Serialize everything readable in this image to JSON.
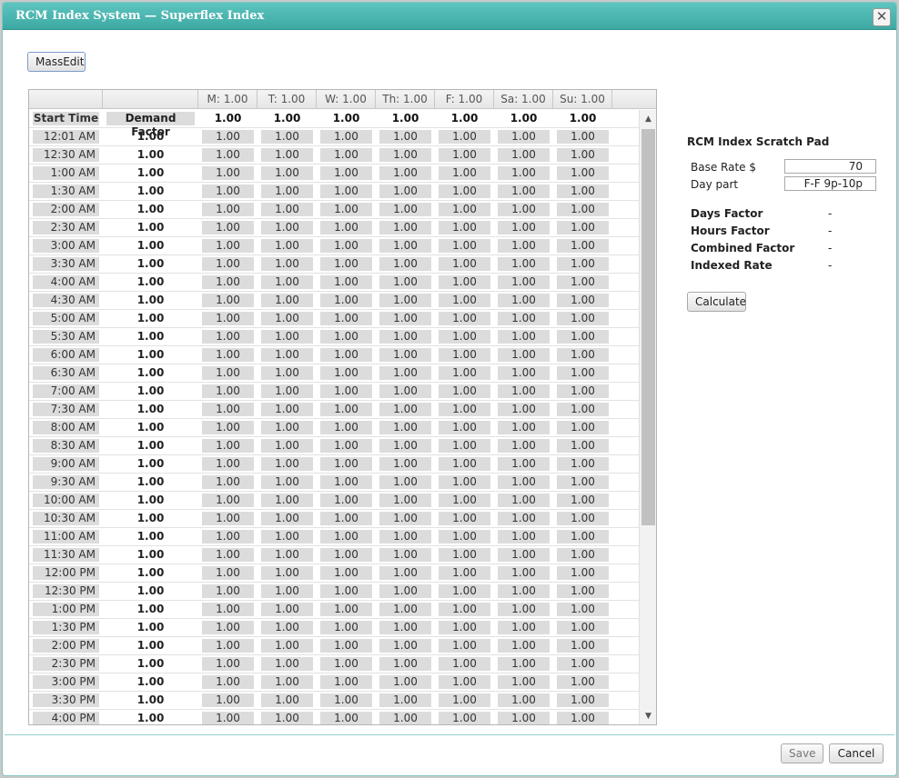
{
  "window": {
    "title": "RCM Index System — Superflex Index",
    "close_glyph": "✕"
  },
  "toolbar": {
    "massedit_label": "MassEdit"
  },
  "grid": {
    "day_headers": [
      "M: 1.00",
      "T: 1.00",
      "W: 1.00",
      "Th: 1.00",
      "F: 1.00",
      "Sa: 1.00",
      "Su: 1.00"
    ],
    "header_row": {
      "start_time": "Start Time",
      "demand_factor": "Demand Factor",
      "day_values": [
        "1.00",
        "1.00",
        "1.00",
        "1.00",
        "1.00",
        "1.00",
        "1.00"
      ]
    },
    "rows": [
      {
        "time": "12:01 AM",
        "demand": "1.00",
        "values": [
          "1.00",
          "1.00",
          "1.00",
          "1.00",
          "1.00",
          "1.00",
          "1.00"
        ]
      },
      {
        "time": "12:30 AM",
        "demand": "1.00",
        "values": [
          "1.00",
          "1.00",
          "1.00",
          "1.00",
          "1.00",
          "1.00",
          "1.00"
        ]
      },
      {
        "time": "1:00 AM",
        "demand": "1.00",
        "values": [
          "1.00",
          "1.00",
          "1.00",
          "1.00",
          "1.00",
          "1.00",
          "1.00"
        ]
      },
      {
        "time": "1:30 AM",
        "demand": "1.00",
        "values": [
          "1.00",
          "1.00",
          "1.00",
          "1.00",
          "1.00",
          "1.00",
          "1.00"
        ]
      },
      {
        "time": "2:00 AM",
        "demand": "1.00",
        "values": [
          "1.00",
          "1.00",
          "1.00",
          "1.00",
          "1.00",
          "1.00",
          "1.00"
        ]
      },
      {
        "time": "2:30 AM",
        "demand": "1.00",
        "values": [
          "1.00",
          "1.00",
          "1.00",
          "1.00",
          "1.00",
          "1.00",
          "1.00"
        ]
      },
      {
        "time": "3:00 AM",
        "demand": "1.00",
        "values": [
          "1.00",
          "1.00",
          "1.00",
          "1.00",
          "1.00",
          "1.00",
          "1.00"
        ]
      },
      {
        "time": "3:30 AM",
        "demand": "1.00",
        "values": [
          "1.00",
          "1.00",
          "1.00",
          "1.00",
          "1.00",
          "1.00",
          "1.00"
        ]
      },
      {
        "time": "4:00 AM",
        "demand": "1.00",
        "values": [
          "1.00",
          "1.00",
          "1.00",
          "1.00",
          "1.00",
          "1.00",
          "1.00"
        ]
      },
      {
        "time": "4:30 AM",
        "demand": "1.00",
        "values": [
          "1.00",
          "1.00",
          "1.00",
          "1.00",
          "1.00",
          "1.00",
          "1.00"
        ]
      },
      {
        "time": "5:00 AM",
        "demand": "1.00",
        "values": [
          "1.00",
          "1.00",
          "1.00",
          "1.00",
          "1.00",
          "1.00",
          "1.00"
        ]
      },
      {
        "time": "5:30 AM",
        "demand": "1.00",
        "values": [
          "1.00",
          "1.00",
          "1.00",
          "1.00",
          "1.00",
          "1.00",
          "1.00"
        ]
      },
      {
        "time": "6:00 AM",
        "demand": "1.00",
        "values": [
          "1.00",
          "1.00",
          "1.00",
          "1.00",
          "1.00",
          "1.00",
          "1.00"
        ]
      },
      {
        "time": "6:30 AM",
        "demand": "1.00",
        "values": [
          "1.00",
          "1.00",
          "1.00",
          "1.00",
          "1.00",
          "1.00",
          "1.00"
        ]
      },
      {
        "time": "7:00 AM",
        "demand": "1.00",
        "values": [
          "1.00",
          "1.00",
          "1.00",
          "1.00",
          "1.00",
          "1.00",
          "1.00"
        ]
      },
      {
        "time": "7:30 AM",
        "demand": "1.00",
        "values": [
          "1.00",
          "1.00",
          "1.00",
          "1.00",
          "1.00",
          "1.00",
          "1.00"
        ]
      },
      {
        "time": "8:00 AM",
        "demand": "1.00",
        "values": [
          "1.00",
          "1.00",
          "1.00",
          "1.00",
          "1.00",
          "1.00",
          "1.00"
        ]
      },
      {
        "time": "8:30 AM",
        "demand": "1.00",
        "values": [
          "1.00",
          "1.00",
          "1.00",
          "1.00",
          "1.00",
          "1.00",
          "1.00"
        ]
      },
      {
        "time": "9:00 AM",
        "demand": "1.00",
        "values": [
          "1.00",
          "1.00",
          "1.00",
          "1.00",
          "1.00",
          "1.00",
          "1.00"
        ]
      },
      {
        "time": "9:30 AM",
        "demand": "1.00",
        "values": [
          "1.00",
          "1.00",
          "1.00",
          "1.00",
          "1.00",
          "1.00",
          "1.00"
        ]
      },
      {
        "time": "10:00 AM",
        "demand": "1.00",
        "values": [
          "1.00",
          "1.00",
          "1.00",
          "1.00",
          "1.00",
          "1.00",
          "1.00"
        ]
      },
      {
        "time": "10:30 AM",
        "demand": "1.00",
        "values": [
          "1.00",
          "1.00",
          "1.00",
          "1.00",
          "1.00",
          "1.00",
          "1.00"
        ]
      },
      {
        "time": "11:00 AM",
        "demand": "1.00",
        "values": [
          "1.00",
          "1.00",
          "1.00",
          "1.00",
          "1.00",
          "1.00",
          "1.00"
        ]
      },
      {
        "time": "11:30 AM",
        "demand": "1.00",
        "values": [
          "1.00",
          "1.00",
          "1.00",
          "1.00",
          "1.00",
          "1.00",
          "1.00"
        ]
      },
      {
        "time": "12:00 PM",
        "demand": "1.00",
        "values": [
          "1.00",
          "1.00",
          "1.00",
          "1.00",
          "1.00",
          "1.00",
          "1.00"
        ]
      },
      {
        "time": "12:30 PM",
        "demand": "1.00",
        "values": [
          "1.00",
          "1.00",
          "1.00",
          "1.00",
          "1.00",
          "1.00",
          "1.00"
        ]
      },
      {
        "time": "1:00 PM",
        "demand": "1.00",
        "values": [
          "1.00",
          "1.00",
          "1.00",
          "1.00",
          "1.00",
          "1.00",
          "1.00"
        ]
      },
      {
        "time": "1:30 PM",
        "demand": "1.00",
        "values": [
          "1.00",
          "1.00",
          "1.00",
          "1.00",
          "1.00",
          "1.00",
          "1.00"
        ]
      },
      {
        "time": "2:00 PM",
        "demand": "1.00",
        "values": [
          "1.00",
          "1.00",
          "1.00",
          "1.00",
          "1.00",
          "1.00",
          "1.00"
        ]
      },
      {
        "time": "2:30 PM",
        "demand": "1.00",
        "values": [
          "1.00",
          "1.00",
          "1.00",
          "1.00",
          "1.00",
          "1.00",
          "1.00"
        ]
      },
      {
        "time": "3:00 PM",
        "demand": "1.00",
        "values": [
          "1.00",
          "1.00",
          "1.00",
          "1.00",
          "1.00",
          "1.00",
          "1.00"
        ]
      },
      {
        "time": "3:30 PM",
        "demand": "1.00",
        "values": [
          "1.00",
          "1.00",
          "1.00",
          "1.00",
          "1.00",
          "1.00",
          "1.00"
        ]
      },
      {
        "time": "4:00 PM",
        "demand": "1.00",
        "values": [
          "1.00",
          "1.00",
          "1.00",
          "1.00",
          "1.00",
          "1.00",
          "1.00"
        ]
      }
    ]
  },
  "scratch_pad": {
    "title": "RCM Index Scratch Pad",
    "base_rate_label": "Base Rate $",
    "base_rate_value": "70",
    "day_part_label": "Day part",
    "day_part_value": "F-F 9p-10p",
    "results": [
      {
        "label": "Days Factor",
        "value": "-"
      },
      {
        "label": "Hours Factor",
        "value": "-"
      },
      {
        "label": "Combined Factor",
        "value": "-"
      },
      {
        "label": "Indexed Rate",
        "value": "-"
      }
    ],
    "calculate_label": "Calculate"
  },
  "footer": {
    "save_label": "Save",
    "cancel_label": "Cancel"
  }
}
